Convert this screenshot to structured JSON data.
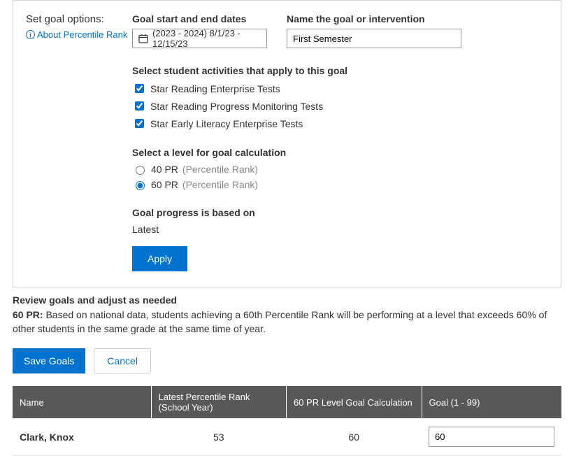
{
  "panel": {
    "set_goal_label": "Set goal options:",
    "about_link": "About Percentile Rank",
    "dates_label": "Goal start and end dates",
    "dates_value": "(2023 - 2024) 8/1/23 - 12/15/23",
    "name_label": "Name the goal or intervention",
    "name_value": "First Semester",
    "activities_label": "Select student activities that apply to this goal",
    "activities": [
      {
        "label": "Star Reading Enterprise Tests",
        "checked": true
      },
      {
        "label": "Star Reading Progress Monitoring Tests",
        "checked": true
      },
      {
        "label": "Star Early Literacy Enterprise Tests",
        "checked": true
      }
    ],
    "level_label": "Select a level for goal calculation",
    "levels": [
      {
        "value": "40 PR",
        "suffix": "(Percentile Rank)",
        "selected": false
      },
      {
        "value": "60 PR",
        "suffix": "(Percentile Rank)",
        "selected": true
      }
    ],
    "progress_label": "Goal progress is based on",
    "progress_value": "Latest",
    "apply_label": "Apply"
  },
  "review": {
    "title": "Review goals and adjust as needed",
    "desc_bold": "60 PR:",
    "desc_rest": " Based on national data, students achieving a 60th Percentile Rank will be performing at a level that exceeds 60% of other students in the same grade at the same time of year."
  },
  "buttons": {
    "save": "Save Goals",
    "cancel": "Cancel"
  },
  "table": {
    "headers": {
      "name": "Name",
      "pr": "Latest Percentile Rank (School Year)",
      "calc": "60 PR Level Goal Calculation",
      "goal": "Goal (1 - 99)"
    },
    "rows": [
      {
        "name": "Clark, Knox",
        "pr": "53",
        "calc": "60",
        "goal": "60"
      }
    ]
  }
}
